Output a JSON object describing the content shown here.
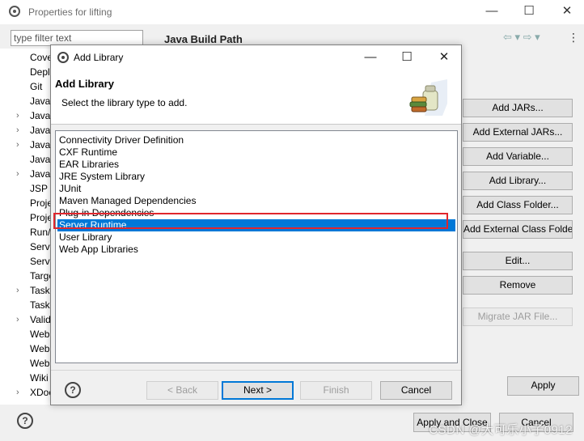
{
  "background_window": {
    "title": "Properties for lifting",
    "controls": {
      "minimize": "—",
      "maximize": "☐",
      "close": "✕"
    },
    "filter_placeholder": "type filter text",
    "section_title": "Java Build Path",
    "nav_arrows": "⇦ ▾  ⇨ ▾",
    "nav_menu": "⋮",
    "tree_items": [
      "Cove",
      "Depl",
      "Git",
      "Java",
      "Java",
      "Java",
      "Java",
      "Javad",
      "JavaS",
      "JSP",
      "Proje",
      "Proje",
      "Run/",
      "Serve",
      "Servi",
      "Targe",
      "Task",
      "Task",
      "Valid",
      "Web",
      "Web",
      "Web",
      "Wiki",
      "XDoc"
    ],
    "right_buttons": [
      "Add JARs...",
      "Add External JARs...",
      "Add Variable...",
      "Add Library...",
      "Add Class Folder...",
      "Add External Class Folder...",
      "Edit...",
      "Remove",
      "Migrate JAR File..."
    ],
    "apply_label": "Apply",
    "apply_close_label": "Apply and Close",
    "cancel_label": "Cancel",
    "help": "?"
  },
  "dialog": {
    "title": "Add Library",
    "controls": {
      "minimize": "—",
      "maximize": "☐",
      "close": "✕"
    },
    "heading": "Add Library",
    "description": "Select the library type to add.",
    "libraries": [
      "Connectivity Driver Definition",
      "CXF Runtime",
      "EAR Libraries",
      "JRE System Library",
      "JUnit",
      "Maven Managed Dependencies",
      "Plug-in Dependencies",
      "Server Runtime",
      "User Library",
      "Web App Libraries"
    ],
    "selected": "Server Runtime",
    "buttons": {
      "back": "< Back",
      "next": "Next >",
      "finish": "Finish",
      "cancel": "Cancel"
    },
    "help": "?"
  },
  "watermark": "CSDN @大可乐小子0912",
  "colors": {
    "selection": "#0078d7",
    "highlight_box": "#e0262d",
    "default_button_border": "#0078d7"
  }
}
